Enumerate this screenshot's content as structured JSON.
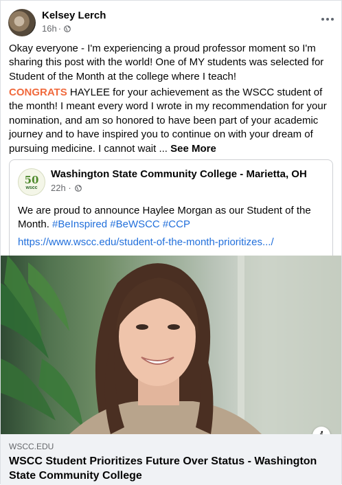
{
  "post": {
    "author": "Kelsey Lerch",
    "time": "16h",
    "text_intro": "Okay everyone - I'm experiencing a proud professor moment so I'm sharing this post with the world! One of MY students was selected for Student of the Month at the college where I teach!",
    "congrats_word": "CONGRATS",
    "text_body": " HAYLEE for your achievement as the WSCC student of the month! I meant every word I wrote in my recommendation for your nomination, and am so honored to have been part of your academic journey and to have inspired you to continue on with your dream of pursuing medicine. I cannot wait ... ",
    "see_more": "See More",
    "colors": {
      "congrats": "#f0693c",
      "link": "#216fdb",
      "meta": "#65676b"
    }
  },
  "shared": {
    "page_name": "Washington State Community College - Marietta, OH",
    "time": "22h",
    "logo_number": "50",
    "logo_text": "wscc",
    "text": "We are proud to announce Haylee Morgan as our Student of the Month. ",
    "hashtags": "#BeInspired #BeWSCC #CCP",
    "url": "https://www.wscc.edu/student-of-the-month-prioritizes.../"
  },
  "link_preview": {
    "domain": "WSCC.EDU",
    "title": "WSCC Student Prioritizes Future Over Status - Washington State Community College",
    "info_icon": "i"
  }
}
